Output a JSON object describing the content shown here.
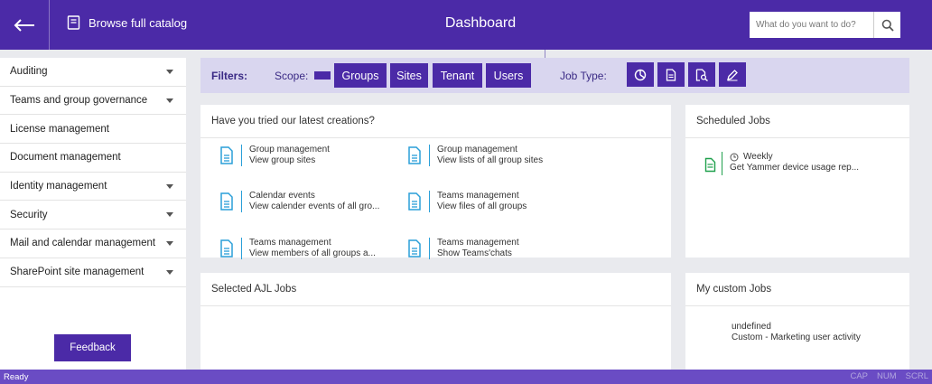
{
  "header": {
    "back_icon": "arrow-left-icon",
    "catalog_label": "Browse full catalog",
    "title": "Dashboard",
    "search_placeholder": "What do you want to do?"
  },
  "sidebar": {
    "items": [
      {
        "label": "Auditing",
        "expandable": true
      },
      {
        "label": "Teams and group governance",
        "expandable": true
      },
      {
        "label": "License management",
        "expandable": false
      },
      {
        "label": "Document management",
        "expandable": false
      },
      {
        "label": "Identity management",
        "expandable": true
      },
      {
        "label": "Security",
        "expandable": true
      },
      {
        "label": "Mail and calendar management",
        "expandable": true
      },
      {
        "label": "SharePoint site management",
        "expandable": true
      }
    ],
    "feedback_label": "Feedback"
  },
  "filters": {
    "label": "Filters:",
    "scope_label": "Scope:",
    "scope_buttons": [
      "Groups",
      "Sites",
      "Tenant",
      "Users"
    ],
    "job_type_label": "Job Type:",
    "job_type_icons": [
      "pie-chart-icon",
      "document-icon",
      "document-search-icon",
      "edit-pen-icon"
    ]
  },
  "creations": {
    "title": "Have you tried our latest creations?",
    "tiles": [
      {
        "title": "Group management",
        "desc": "View group sites"
      },
      {
        "title": "Group management",
        "desc": "View lists of all group sites"
      },
      {
        "title": "Calendar events",
        "desc": "View calender events of all gro..."
      },
      {
        "title": "Teams management",
        "desc": "View files of all groups"
      },
      {
        "title": "Teams management",
        "desc": "View members of all groups a..."
      },
      {
        "title": "Teams management",
        "desc": "Show Teams'chats"
      }
    ]
  },
  "scheduled": {
    "title": "Scheduled Jobs",
    "job": {
      "frequency": "Weekly",
      "desc": "Get Yammer device usage rep..."
    }
  },
  "ajl": {
    "title": "Selected AJL Jobs"
  },
  "custom": {
    "title": "My custom Jobs",
    "job": {
      "name": "undefined",
      "desc": "Custom - Marketing user activity"
    }
  },
  "status": {
    "left": "Ready",
    "indicators": [
      "CAP",
      "NUM",
      "SCRL"
    ]
  },
  "colors": {
    "brand": "#4b2aa7",
    "filter_bg": "#d9d6ef",
    "doc_icon": "#2a9fd8",
    "sched_icon": "#1fa04c"
  }
}
